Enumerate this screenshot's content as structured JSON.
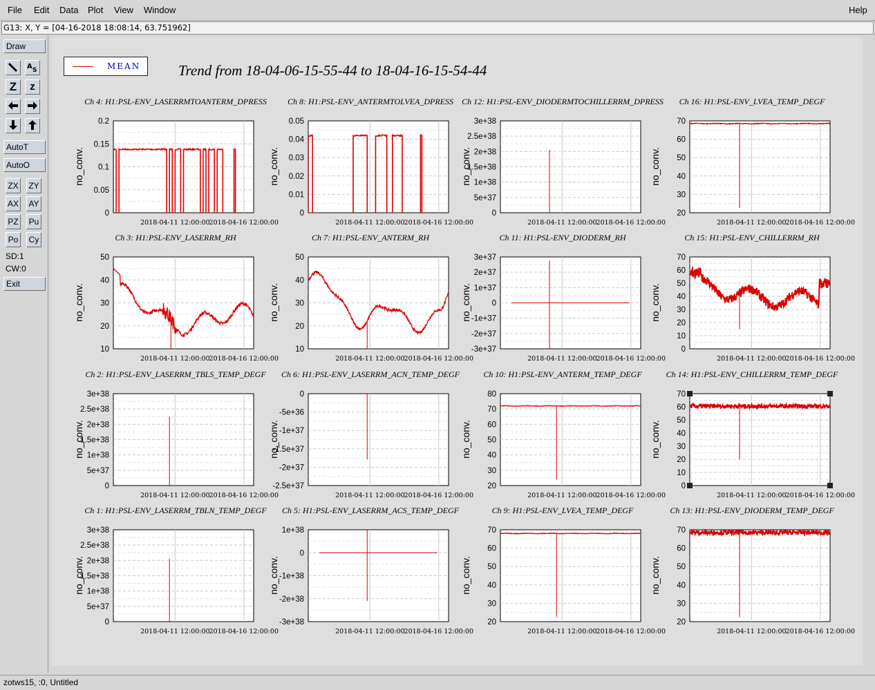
{
  "menubar": {
    "items": [
      "File",
      "Edit",
      "Data",
      "Plot",
      "View",
      "Window"
    ],
    "help": "Help"
  },
  "coordbar": {
    "text": "G13: X, Y = [04-16-2018 18:08:14, 63.751962]"
  },
  "toolbar": {
    "draw": "Draw",
    "autot": "AutoT",
    "autoo": "AutoO",
    "zoom_labels": [
      "Z",
      "z"
    ],
    "grid_buttons": [
      [
        "ZX",
        "ZY"
      ],
      [
        "AX",
        "AY"
      ],
      [
        "PZ",
        "Pu"
      ],
      [
        "Po",
        "Cy"
      ]
    ],
    "sd": "SD:1",
    "cw": "CW:0",
    "exit": "Exit",
    "icons": [
      "wrench-icon",
      "text-scale-icon",
      "zoom-in-icon",
      "zoom-out-icon",
      "arrow-left-icon",
      "arrow-right-icon",
      "arrow-down-icon",
      "arrow-up-icon"
    ]
  },
  "legend": {
    "label": "MEAN",
    "color": "#dd0000"
  },
  "title": "Trend from 18-04-06-15-55-44 to 18-04-16-15-54-44",
  "statusbar": "zotws15, :0, Untitled",
  "colors": {
    "trace": "#dd0000",
    "panel_bg": "#dedede",
    "plot_bg": "#ffffff"
  },
  "chart_data": [
    {
      "type": "line",
      "title": "Ch 4: H1:PSL-ENV_LASERRMTOANTERM_DPRESS",
      "ylabel": "no_conv.",
      "xticks": [
        "2018-04-11 12:00:00",
        "2018-04-16 12:00:00"
      ],
      "yticks": [
        "0",
        "0.05",
        "0.1",
        "0.15",
        "0.2"
      ],
      "ylim": [
        0,
        0.2
      ],
      "pattern": "dropouts",
      "base": 0.138,
      "drop": 0
    },
    {
      "type": "line",
      "title": "Ch 8: H1:PSL-ENV_ANTERMTOLVEA_DPRESS",
      "ylabel": "no_conv.",
      "xticks": [
        "2018-04-11 12:00:00",
        "2018-04-16 12:00:00"
      ],
      "yticks": [
        "0",
        "0.01",
        "0.02",
        "0.03",
        "0.04",
        "0.05"
      ],
      "ylim": [
        0,
        0.05
      ],
      "pattern": "dropouts2",
      "base": 0.042,
      "drop": 0
    },
    {
      "type": "line",
      "title": "Ch 12: H1:PSL-ENV_DIODERMTOCHILLERRM_DPRESS",
      "ylabel": "no_conv.",
      "xticks": [
        "2018-04-11 12:00:00",
        "2018-04-16 12:00:00"
      ],
      "yticks": [
        "0",
        "5e+37",
        "1e+38",
        "1.5e+38",
        "2e+38",
        "2.5e+38",
        "3e+38"
      ],
      "ylim": [
        0,
        3e+38
      ],
      "pattern": "spike",
      "spike": [
        0,
        2.05e+38
      ],
      "spike_frac": 0.35
    },
    {
      "type": "line",
      "title": "Ch 16: H1:PSL-ENV_LVEA_TEMP_DEGF",
      "ylabel": "no_conv.",
      "xticks": [
        "2018-04-11 12:00:00",
        "2018-04-16 12:00:00"
      ],
      "yticks": [
        "20",
        "30",
        "40",
        "50",
        "60",
        "70"
      ],
      "ylim": [
        20,
        70
      ],
      "pattern": "flat",
      "base": 68.5,
      "noise": 0.4,
      "spike_frac": 0.355,
      "spike_min": 22.5
    },
    {
      "type": "line",
      "title": "Ch 3: H1:PSL-ENV_LASERRM_RH",
      "ylabel": "no_conv.",
      "xticks": [
        "2018-04-11 12:00:00",
        "2018-04-16 12:00:00"
      ],
      "yticks": [
        "10",
        "20",
        "30",
        "40",
        "50"
      ],
      "ylim": [
        10,
        50
      ],
      "pattern": "humid1",
      "spike_frac": 0.41,
      "spike_min": 10
    },
    {
      "type": "line",
      "title": "Ch 7: H1:PSL-ENV_ANTERM_RH",
      "ylabel": "no_conv.",
      "xticks": [
        "2018-04-11 12:00:00",
        "2018-04-16 12:00:00"
      ],
      "yticks": [
        "10",
        "20",
        "30",
        "40",
        "50"
      ],
      "ylim": [
        10,
        50
      ],
      "pattern": "humid2",
      "spike_frac": 0.42,
      "spike_min": 10
    },
    {
      "type": "line",
      "title": "Ch 11: H1:PSL-ENV_DIODERM_RH",
      "ylabel": "no_conv.",
      "xticks": [
        "2018-04-11 12:00:00",
        "2018-04-16 12:00:00"
      ],
      "yticks": [
        "-3e+37",
        "-2e+37",
        "-1e+37",
        "0",
        "1e+37",
        "2e+37",
        "3e+37"
      ],
      "ylim": [
        -3e+37,
        3e+37
      ],
      "pattern": "cross",
      "hline": 0,
      "hx": [
        0.08,
        0.92
      ],
      "spike": [
        -3e+37,
        2.75e+37
      ],
      "spike_frac": 0.35
    },
    {
      "type": "line",
      "title": "Ch 15: H1:PSL-ENV_CHILLERRM_RH",
      "ylabel": "no_conv.",
      "xticks": [
        "2018-04-11 12:00:00",
        "2018-04-16 12:00:00"
      ],
      "yticks": [
        "0",
        "10",
        "20",
        "30",
        "40",
        "50",
        "60",
        "70"
      ],
      "ylim": [
        0,
        70
      ],
      "pattern": "chillerRH",
      "spike_frac": 0.355,
      "spike_min": 15
    },
    {
      "type": "line",
      "title": "Ch 2: H1:PSL-ENV_LASERRM_TBLS_TEMP_DEGF",
      "ylabel": "no_conv.",
      "xticks": [
        "2018-04-11 12:00:00",
        "2018-04-16 12:00:00"
      ],
      "yticks": [
        "0",
        "5e+37",
        "1e+38",
        "1.5e+38",
        "2e+38",
        "2.5e+38",
        "3e+38"
      ],
      "ylim": [
        0,
        3e+38
      ],
      "pattern": "spike",
      "spike": [
        0,
        2.25e+38
      ],
      "spike_frac": 0.4
    },
    {
      "type": "line",
      "title": "Ch 6: H1:PSL-ENV_LASERRM_ACN_TEMP_DEGF",
      "ylabel": "no_conv.",
      "xticks": [
        "2018-04-11 12:00:00",
        "2018-04-16 12:00:00"
      ],
      "yticks": [
        "-2.5e+37",
        "-2e+37",
        "-1.5e+37",
        "-1e+37",
        "-5e+36",
        "0"
      ],
      "ylim": [
        -3e+37,
        0
      ],
      "pattern": "spike",
      "spike": [
        -2.15e+37,
        0
      ],
      "spike_frac": 0.42
    },
    {
      "type": "line",
      "title": "Ch 10: H1:PSL-ENV_ANTERM_TEMP_DEGF",
      "ylabel": "no_conv.",
      "xticks": [
        "2018-04-11 12:00:00",
        "2018-04-16 12:00:00"
      ],
      "yticks": [
        "20",
        "30",
        "40",
        "50",
        "60",
        "70",
        "80"
      ],
      "ylim": [
        20,
        80
      ],
      "pattern": "flat",
      "base": 72,
      "noise": 0.3,
      "spike_frac": 0.4,
      "spike_min": 24
    },
    {
      "type": "line",
      "title": "Ch 14: H1:PSL-ENV_CHILLERRM_TEMP_DEGF",
      "ylabel": "no_conv.",
      "xticks": [
        "2018-04-11 12:00:00",
        "2018-04-16 12:00:00"
      ],
      "yticks": [
        "0",
        "10",
        "20",
        "30",
        "40",
        "50",
        "60",
        "70"
      ],
      "ylim": [
        0,
        70
      ],
      "pattern": "noisy",
      "base": 60.5,
      "noise": 1.6,
      "spike_frac": 0.355,
      "spike_min": 20,
      "selected": true
    },
    {
      "type": "line",
      "title": "Ch 1: H1:PSL-ENV_LASERRM_TBLN_TEMP_DEGF",
      "ylabel": "no_conv.",
      "xticks": [
        "2018-04-11 12:00:00",
        "2018-04-16 12:00:00"
      ],
      "yticks": [
        "0",
        "5e+37",
        "1e+38",
        "1.5e+38",
        "2e+38",
        "2.5e+38",
        "3e+38"
      ],
      "ylim": [
        0,
        3e+38
      ],
      "pattern": "spike",
      "spike": [
        0,
        2.05e+38
      ],
      "spike_frac": 0.4
    },
    {
      "type": "line",
      "title": "Ch 5: H1:PSL-ENV_LASERRM_ACS_TEMP_DEGF",
      "ylabel": "no_conv.",
      "xticks": [
        "2018-04-11 12:00:00",
        "2018-04-16 12:00:00"
      ],
      "yticks": [
        "-3e+38",
        "-2e+38",
        "-1e+38",
        "0",
        "1e+38"
      ],
      "ylim": [
        -3e+38,
        1e+38
      ],
      "pattern": "cross",
      "hline": 0,
      "hx": [
        0.08,
        0.92
      ],
      "spike": [
        -2.1e+38,
        1e+38
      ],
      "spike_frac": 0.42
    },
    {
      "type": "line",
      "title": "Ch 9: H1:PSL-ENV_LVEA_TEMP_DEGF",
      "ylabel": "no_conv.",
      "xticks": [
        "2018-04-11 12:00:00",
        "2018-04-16 12:00:00"
      ],
      "yticks": [
        "20",
        "30",
        "40",
        "50",
        "60",
        "70"
      ],
      "ylim": [
        20,
        70
      ],
      "pattern": "flat",
      "base": 68,
      "noise": 0.3,
      "spike_frac": 0.4,
      "spike_min": 22.5
    },
    {
      "type": "line",
      "title": "Ch 13: H1:PSL-ENV_DIODERM_TEMP_DEGF",
      "ylabel": "no_conv.",
      "xticks": [
        "2018-04-11 12:00:00",
        "2018-04-16 12:00:00"
      ],
      "yticks": [
        "20",
        "30",
        "40",
        "50",
        "60",
        "70"
      ],
      "ylim": [
        20,
        70
      ],
      "pattern": "noisy",
      "base": 68.5,
      "noise": 1.3,
      "spike_frac": 0.355,
      "spike_min": 22.5
    }
  ]
}
